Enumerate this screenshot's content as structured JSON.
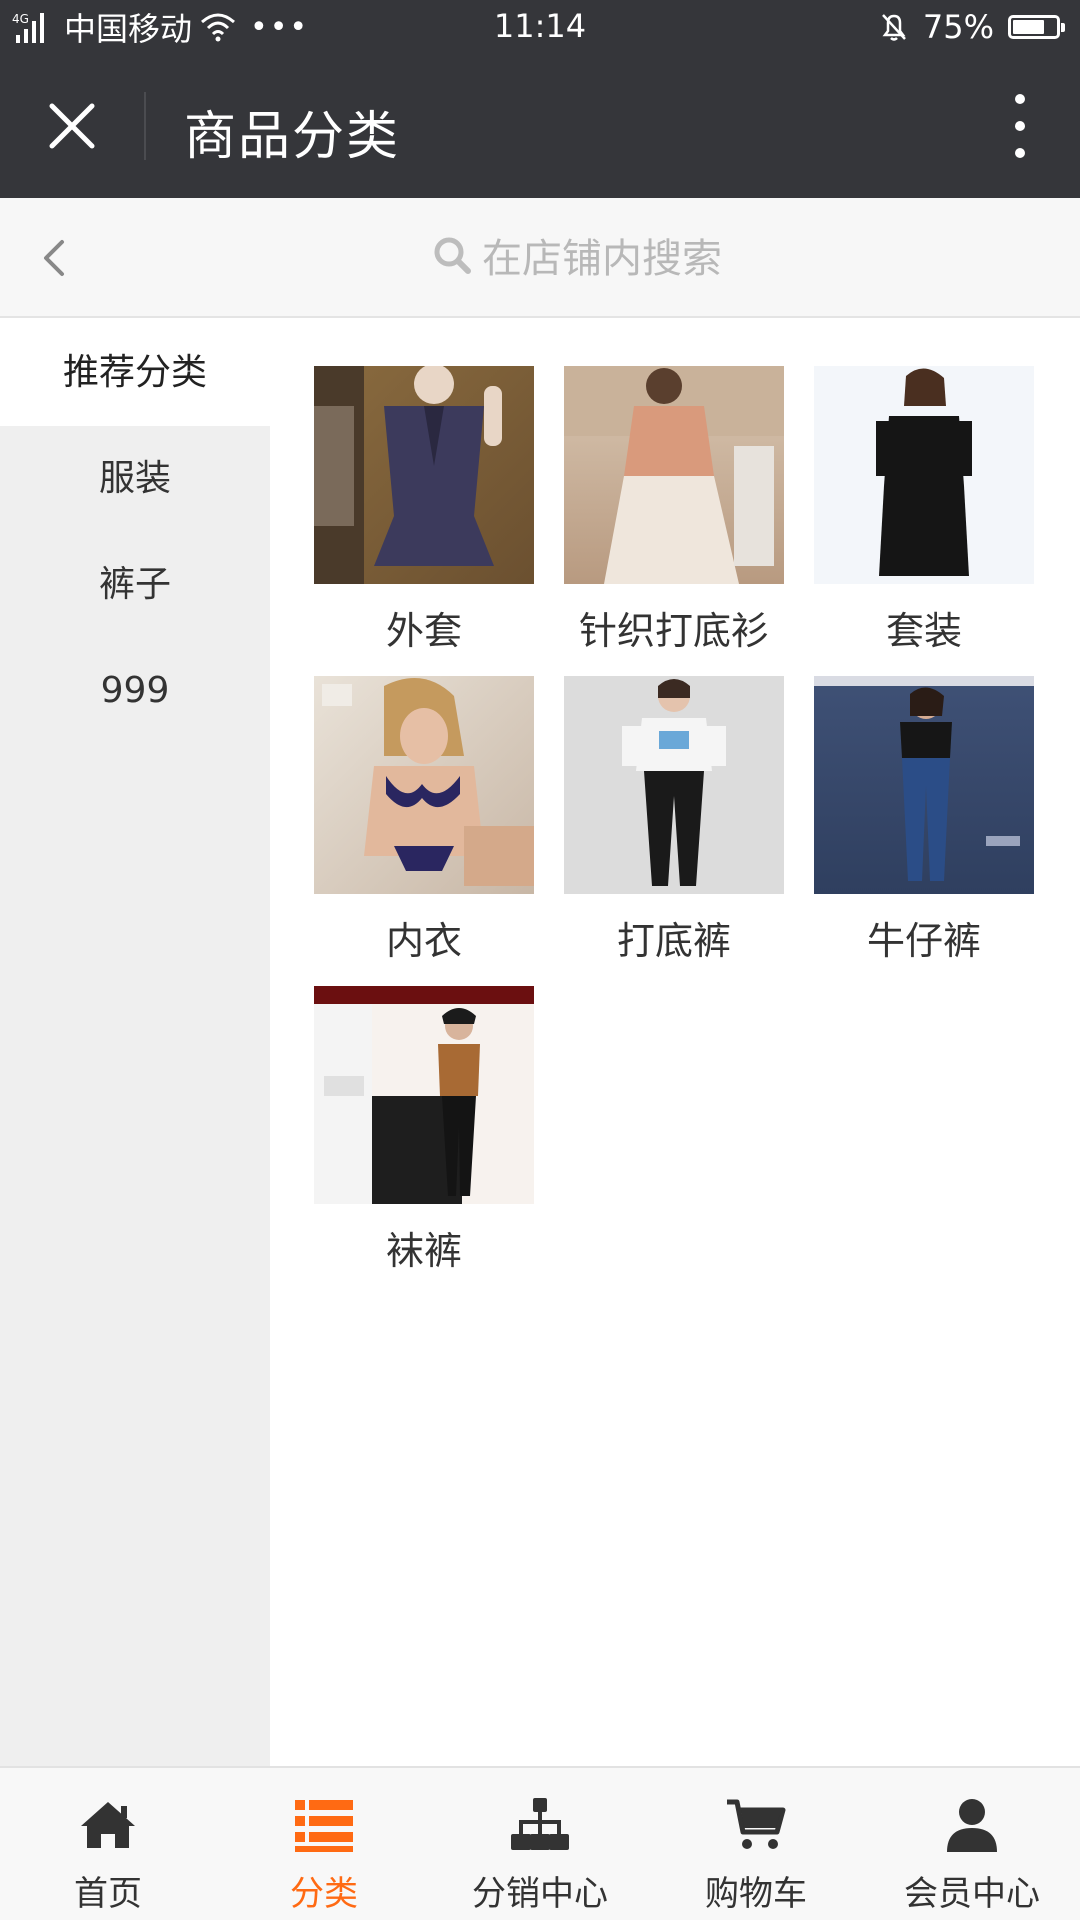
{
  "status_bar": {
    "network": "4G",
    "carrier": "中国移动",
    "time": "11:14",
    "battery": "75%",
    "battery_level": 0.75
  },
  "header": {
    "title": "商品分类"
  },
  "search": {
    "placeholder": "在店铺内搜索"
  },
  "sidebar": {
    "items": [
      {
        "label": "推荐分类"
      },
      {
        "label": "服装"
      },
      {
        "label": "裤子"
      },
      {
        "label": "999"
      }
    ]
  },
  "grid": {
    "items": [
      {
        "label": "外套"
      },
      {
        "label": "针织打底衫"
      },
      {
        "label": "套装"
      },
      {
        "label": "内衣"
      },
      {
        "label": "打底裤"
      },
      {
        "label": "牛仔裤"
      },
      {
        "label": "袜裤"
      }
    ]
  },
  "tabbar": {
    "tabs": [
      {
        "label": "首页",
        "icon": "home-icon"
      },
      {
        "label": "分类",
        "icon": "list-icon"
      },
      {
        "label": "分销中心",
        "icon": "sitemap-icon"
      },
      {
        "label": "购物车",
        "icon": "cart-icon"
      },
      {
        "label": "会员中心",
        "icon": "user-icon"
      }
    ],
    "active_color": "#ff6a13",
    "inactive_color": "#333333"
  }
}
